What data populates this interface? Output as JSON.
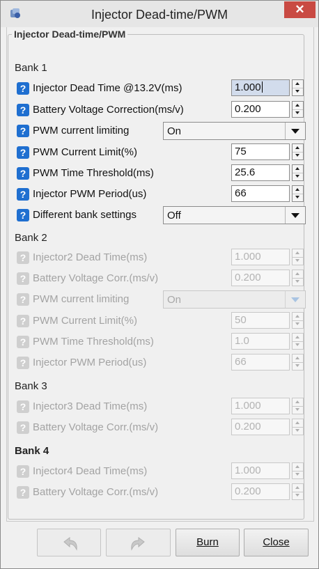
{
  "window": {
    "title": "Injector Dead-time/PWM",
    "close_symbol": "✕"
  },
  "group": {
    "title": "Injector Dead-time/PWM"
  },
  "help_glyph": "?",
  "sections": {
    "bank1": "Bank 1",
    "bank2": "Bank 2",
    "bank3": "Bank 3",
    "bank4": "Bank 4"
  },
  "bank1": {
    "dead_time": {
      "label": "Injector Dead Time @13.2V(ms)",
      "value": "1.000"
    },
    "battery_corr": {
      "label": "Battery Voltage Correction(ms/v)",
      "value": "0.200"
    },
    "pwm_limiting": {
      "label": "PWM current limiting",
      "value": "On"
    },
    "pwm_current_limit": {
      "label": "PWM Current Limit(%)",
      "value": "75"
    },
    "pwm_time_threshold": {
      "label": "PWM Time Threshold(ms)",
      "value": "25.6"
    },
    "pwm_period": {
      "label": "Injector PWM Period(us)",
      "value": "66"
    },
    "diff_bank": {
      "label": "Different bank settings",
      "value": "Off"
    }
  },
  "bank2": {
    "dead_time": {
      "label": "Injector2 Dead Time(ms)",
      "value": "1.000"
    },
    "battery_corr": {
      "label": "Battery Voltage Corr.(ms/v)",
      "value": "0.200"
    },
    "pwm_limiting": {
      "label": "PWM current limiting",
      "value": "On"
    },
    "pwm_current_limit": {
      "label": "PWM Current Limit(%)",
      "value": "50"
    },
    "pwm_time_threshold": {
      "label": "PWM Time Threshold(ms)",
      "value": "1.0"
    },
    "pwm_period": {
      "label": "Injector PWM Period(us)",
      "value": "66"
    }
  },
  "bank3": {
    "dead_time": {
      "label": "Injector3 Dead Time(ms)",
      "value": "1.000"
    },
    "battery_corr": {
      "label": "Battery Voltage Corr.(ms/v)",
      "value": "0.200"
    }
  },
  "bank4": {
    "dead_time": {
      "label": "Injector4 Dead Time(ms)",
      "value": "1.000"
    },
    "battery_corr": {
      "label": "Battery Voltage Corr.(ms/v)",
      "value": "0.200"
    }
  },
  "buttons": {
    "undo_icon": "undo-icon",
    "redo_icon": "redo-icon",
    "burn": "Burn",
    "close": "Close"
  },
  "colors": {
    "help_active": "#1f6fd0",
    "close_button": "#c94a43",
    "selected_field": "#d2dcec"
  }
}
